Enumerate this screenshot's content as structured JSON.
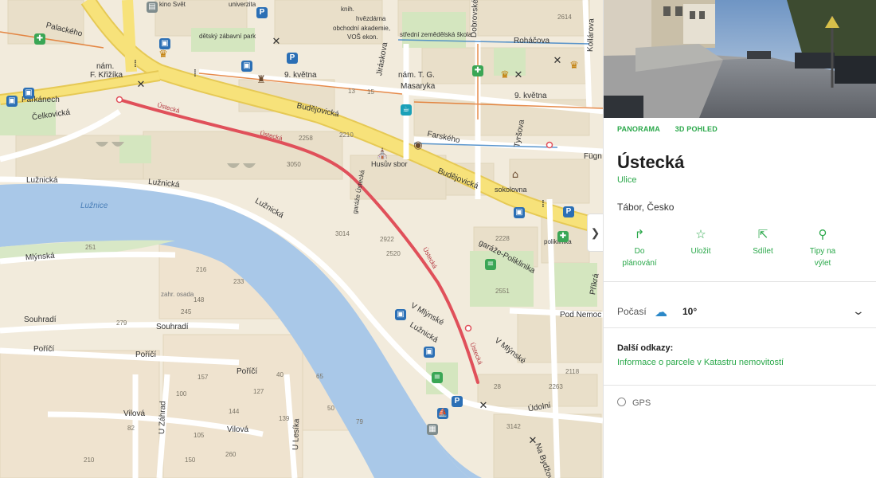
{
  "map": {
    "street_labels": [
      {
        "text": "Palackého"
      },
      {
        "text": "Parkánech"
      },
      {
        "text": "Čelkovická"
      },
      {
        "text": "nám."
      },
      {
        "text": "F. Křižíka"
      },
      {
        "text": "Budějovická"
      },
      {
        "text": "Budějovická"
      },
      {
        "text": "9. května"
      },
      {
        "text": "9. května"
      },
      {
        "text": "nám. T. G."
      },
      {
        "text": "Masaryka"
      },
      {
        "text": "Farského"
      },
      {
        "text": "Fügn"
      },
      {
        "text": "Roháčova"
      },
      {
        "text": "Jiráskova"
      },
      {
        "text": "Dobrovského"
      },
      {
        "text": "Kollárova"
      },
      {
        "text": "Tyršova"
      },
      {
        "text": "Lužnická"
      },
      {
        "text": "Lužnická"
      },
      {
        "text": "Lužnická"
      },
      {
        "text": "Lužnice"
      },
      {
        "text": "Mlýnská"
      },
      {
        "text": "Souhradí"
      },
      {
        "text": "Souhradí"
      },
      {
        "text": "Poříčí"
      },
      {
        "text": "Poříčí"
      },
      {
        "text": "Poříčí"
      },
      {
        "text": "Vilová"
      },
      {
        "text": "Vilová"
      },
      {
        "text": "U Záhrad"
      },
      {
        "text": "U Lesíka"
      },
      {
        "text": "V Mlýnské"
      },
      {
        "text": "V Mlýnské"
      },
      {
        "text": "Lužnická"
      },
      {
        "text": "Pod Nemoc"
      },
      {
        "text": "Údolní"
      },
      {
        "text": "Na Bydžov"
      },
      {
        "text": "Příkrá"
      },
      {
        "text": "garáže-Poliklinika"
      },
      {
        "text": "Ústecká"
      },
      {
        "text": "Ústecká"
      },
      {
        "text": "Ústecká"
      },
      {
        "text": "Ústecká"
      },
      {
        "text": "zahr. osada"
      },
      {
        "text": "Husův sbor"
      },
      {
        "text": "sokolovna"
      },
      {
        "text": "poliklinika"
      },
      {
        "text": "garáže Ústecká"
      },
      {
        "text": "univerzita"
      },
      {
        "text": "dětský zábavní park"
      },
      {
        "text": "knih."
      },
      {
        "text": "hvězdárna"
      },
      {
        "text": "obchodní akademie,"
      },
      {
        "text": "VOŠ ekon."
      },
      {
        "text": "střední zemědělská škola"
      },
      {
        "text": "kino Svět"
      }
    ],
    "numbers": [
      "2258",
      "2210",
      "3050",
      "2614",
      "13",
      "15",
      "3014",
      "2922",
      "2520",
      "2551",
      "2228",
      "251",
      "233",
      "216",
      "148",
      "245",
      "279",
      "157",
      "127",
      "100",
      "144",
      "105",
      "139",
      "210",
      "82",
      "150",
      "260",
      "2263",
      "3142",
      "28",
      "40",
      "65",
      "50",
      "79",
      "2118"
    ]
  },
  "panel": {
    "tabs": [
      "PANORAMA",
      "3D POHLED"
    ],
    "title": "Ústecká",
    "subtitle": "Ulice",
    "location": "Tábor, Česko",
    "actions": [
      {
        "label_1": "Do",
        "label_2": "plánování",
        "icon": "route-icon"
      },
      {
        "label_1": "Uložit",
        "label_2": "",
        "icon": "star-icon"
      },
      {
        "label_1": "Sdílet",
        "label_2": "",
        "icon": "share-icon"
      },
      {
        "label_1": "Tipy na",
        "label_2": "výlet",
        "icon": "hiker-icon"
      }
    ],
    "weather": {
      "label": "Počasí",
      "temp": "10°",
      "icon": "cloud-rain-icon"
    },
    "links": {
      "heading": "Další odkazy:",
      "link": "Informace o parcele v Katastru nemovitostí"
    },
    "gps": "GPS"
  },
  "colors": {
    "route": "#e0505a",
    "accent": "#2aa84a",
    "river": "#a9c8e8",
    "main_road": "#f7e27a",
    "park": "#d7e8c2"
  }
}
